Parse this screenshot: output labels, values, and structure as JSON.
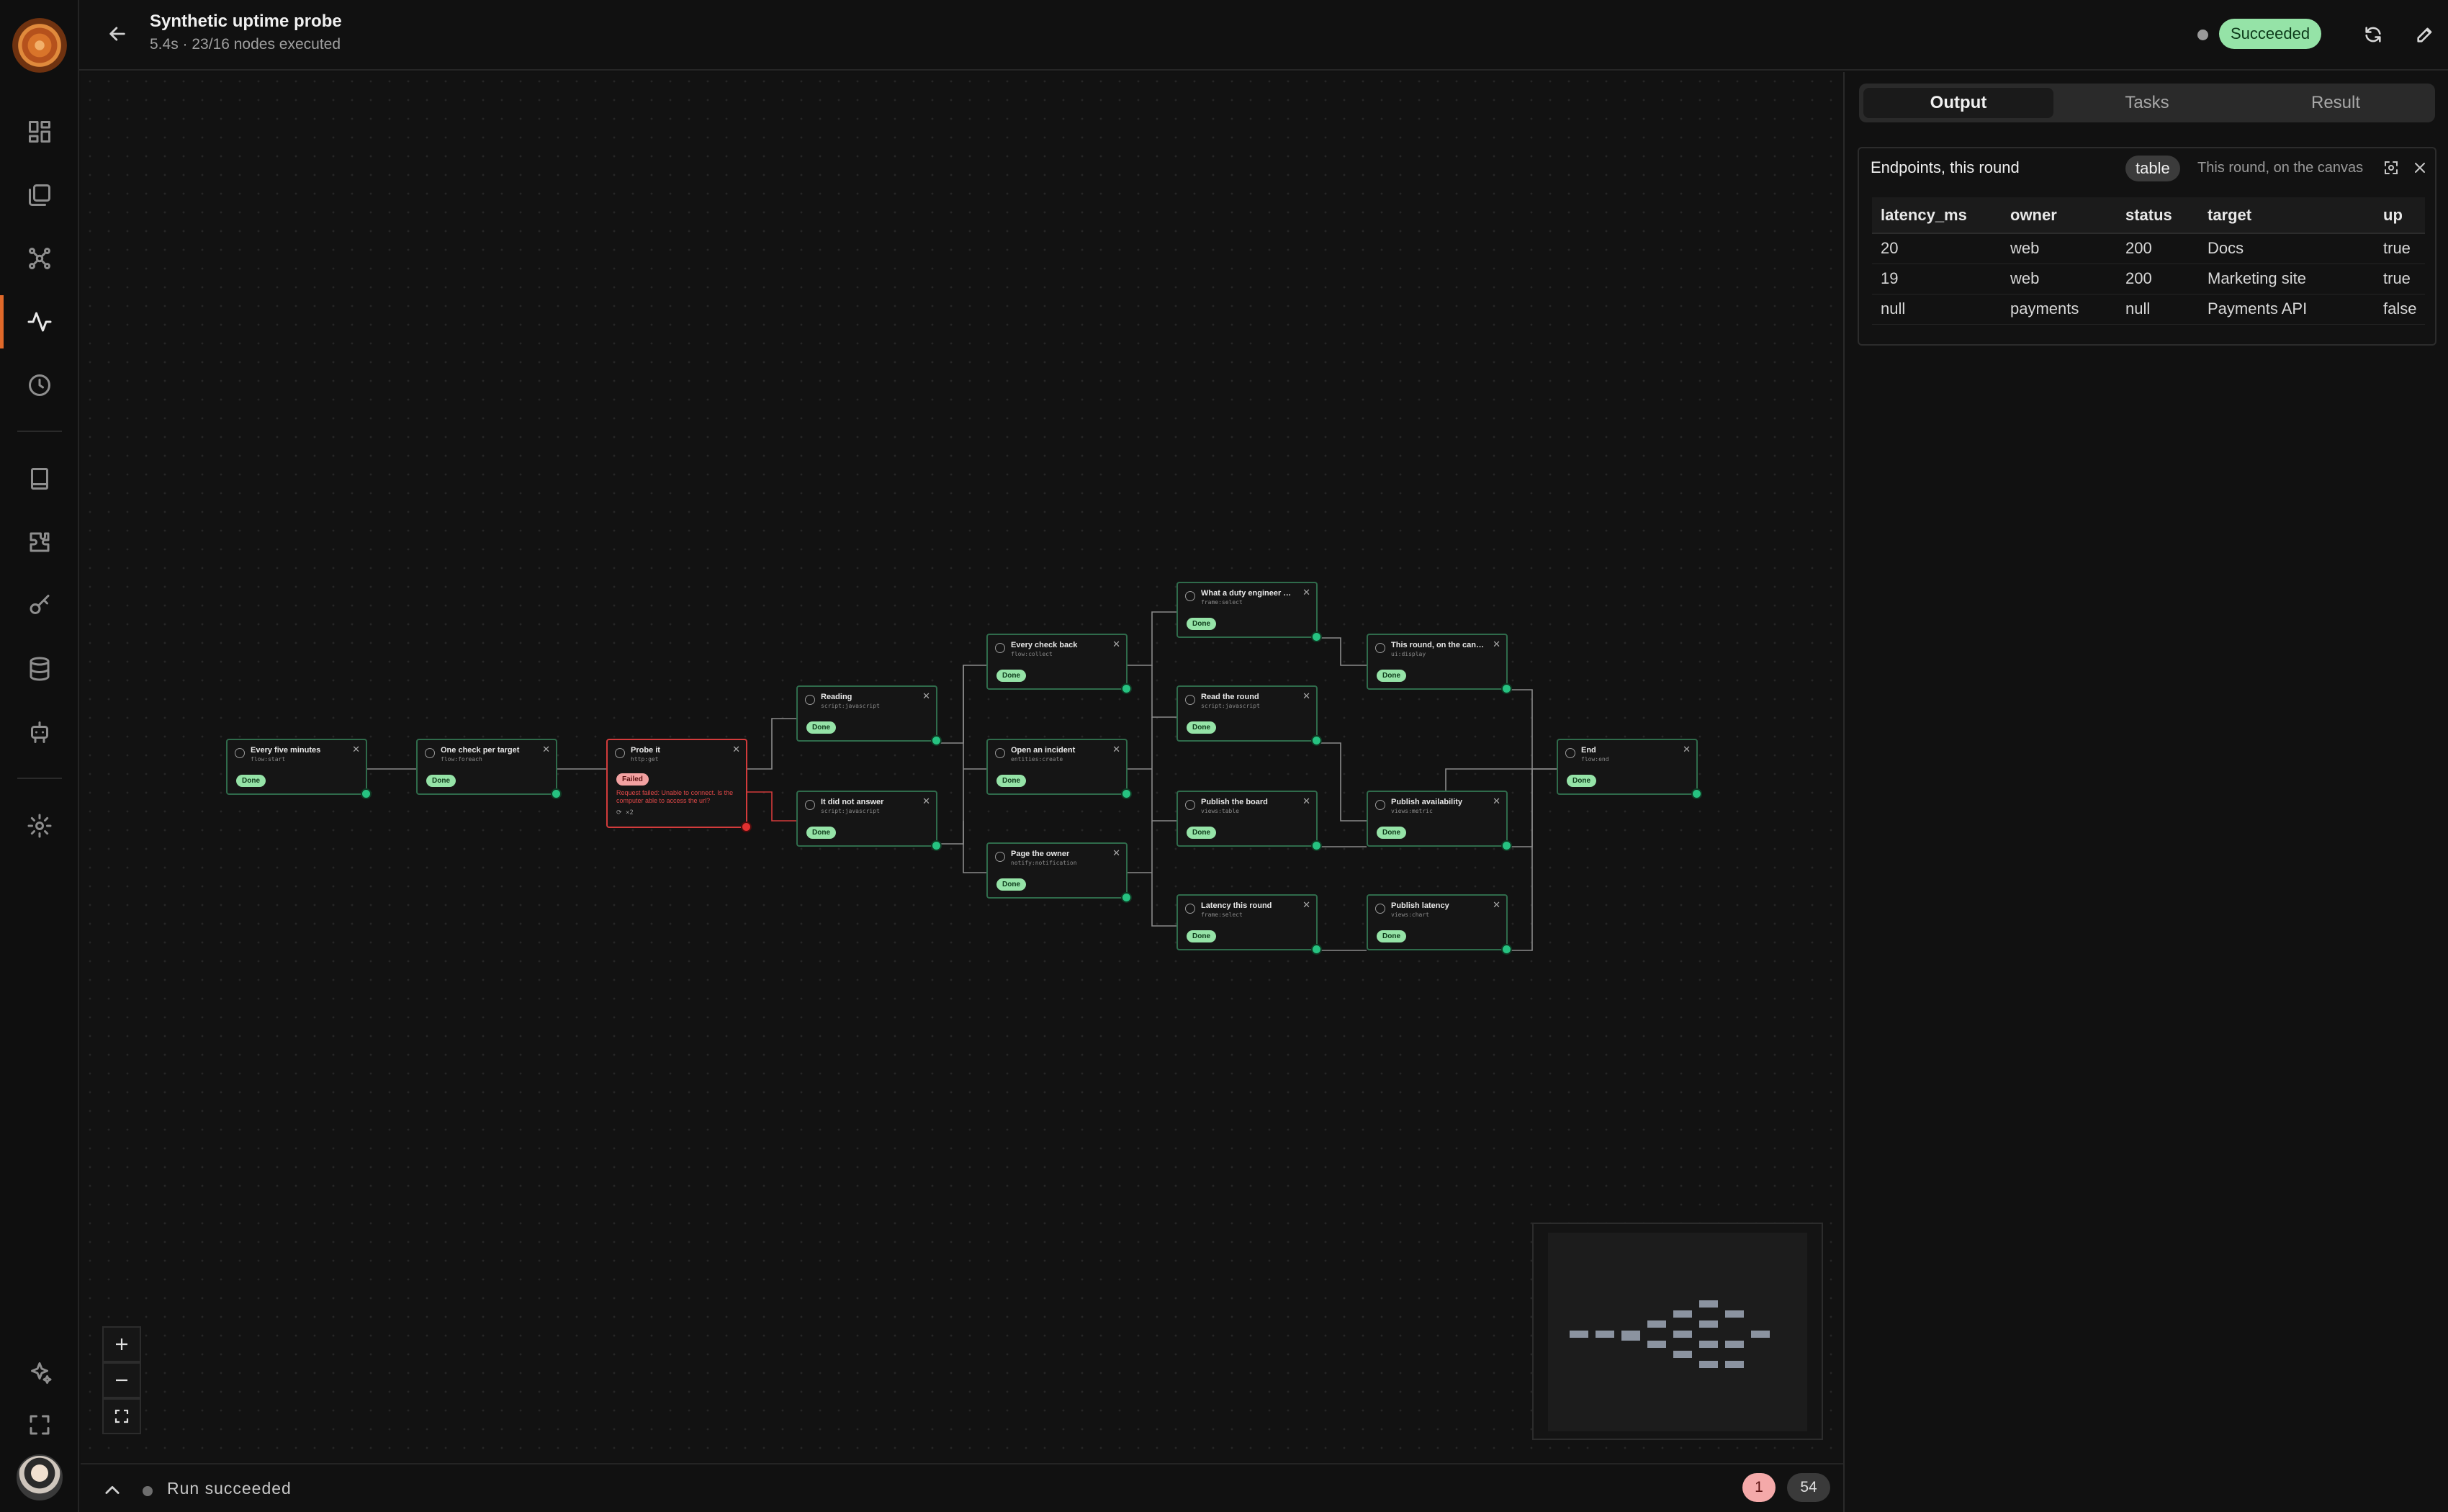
{
  "header": {
    "title": "Synthetic uptime probe",
    "subtitle": "5.4s · 23/16 nodes executed",
    "status": "Succeeded"
  },
  "nodes": [
    {
      "id": "n1",
      "title": "Every five minutes",
      "type": "flow:start",
      "status": "Done"
    },
    {
      "id": "n2",
      "title": "One check per target",
      "type": "flow:foreach",
      "status": "Done"
    },
    {
      "id": "n3",
      "title": "Probe it",
      "type": "http:get",
      "status": "Failed",
      "error": "Request failed: Unable to connect. Is the computer able to access the url?",
      "retries": "⟳ ×2"
    },
    {
      "id": "n4",
      "title": "Reading",
      "type": "script:javascript",
      "status": "Done"
    },
    {
      "id": "n5",
      "title": "It did not answer",
      "type": "script:javascript",
      "status": "Done"
    },
    {
      "id": "n6",
      "title": "Every check back",
      "type": "flow:collect",
      "status": "Done"
    },
    {
      "id": "n7",
      "title": "Open an incident",
      "type": "entities:create",
      "status": "Done"
    },
    {
      "id": "n8",
      "title": "Page the owner",
      "type": "notify:notification",
      "status": "Done"
    },
    {
      "id": "n9",
      "title": "What a duty engineer ne...",
      "type": "frame:select",
      "status": "Done"
    },
    {
      "id": "n10",
      "title": "Read the round",
      "type": "script:javascript",
      "status": "Done"
    },
    {
      "id": "n11",
      "title": "Publish the board",
      "type": "views:table",
      "status": "Done"
    },
    {
      "id": "n12",
      "title": "Latency this round",
      "type": "frame:select",
      "status": "Done"
    },
    {
      "id": "n13",
      "title": "This round, on the canvas",
      "type": "ui:display",
      "status": "Done"
    },
    {
      "id": "n14",
      "title": "Publish availability",
      "type": "views:metric",
      "status": "Done"
    },
    {
      "id": "n15",
      "title": "Publish latency",
      "type": "views:chart",
      "status": "Done"
    },
    {
      "id": "n16",
      "title": "End",
      "type": "flow:end",
      "status": "Done"
    }
  ],
  "statusbar": {
    "text": "Run  succeeded",
    "error_count": "1",
    "log_count": "54"
  },
  "panel": {
    "tabs": [
      "Output",
      "Tasks",
      "Result"
    ],
    "active_tab": "Output",
    "card": {
      "title": "Endpoints, this round",
      "format": "table",
      "source": "This round, on the canvas",
      "columns": [
        "latency_ms",
        "owner",
        "status",
        "target",
        "up"
      ],
      "rows": [
        [
          "20",
          "web",
          "200",
          "Docs",
          "true"
        ],
        [
          "19",
          "web",
          "200",
          "Marketing site",
          "true"
        ],
        [
          "null",
          "payments",
          "null",
          "Payments API",
          "false"
        ]
      ]
    }
  },
  "colors": {
    "accent": "#e0692a",
    "success": "#95e3a7",
    "error": "#d23b3b",
    "port": "#26c281"
  },
  "icons": {
    "rail": [
      "dashboard-icon",
      "pages-icon",
      "workflows-icon",
      "runs-icon",
      "schedule-icon",
      "docs-icon",
      "plugins-icon",
      "keys-icon",
      "database-icon",
      "bot-icon",
      "settings-icon",
      "sparkles-icon",
      "fullscreen-icon"
    ],
    "header": [
      "back-arrow-icon",
      "refresh-icon",
      "edit-icon"
    ]
  }
}
